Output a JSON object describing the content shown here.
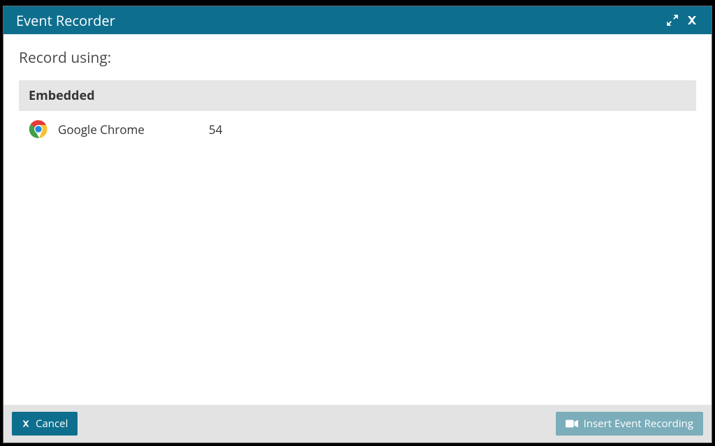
{
  "dialog": {
    "title": "Event Recorder"
  },
  "body": {
    "record_label": "Record using:",
    "section_header": "Embedded",
    "browsers": [
      {
        "name": "Google Chrome",
        "version": "54"
      }
    ]
  },
  "footer": {
    "cancel_label": "Cancel",
    "insert_label": "Insert Event Recording"
  }
}
